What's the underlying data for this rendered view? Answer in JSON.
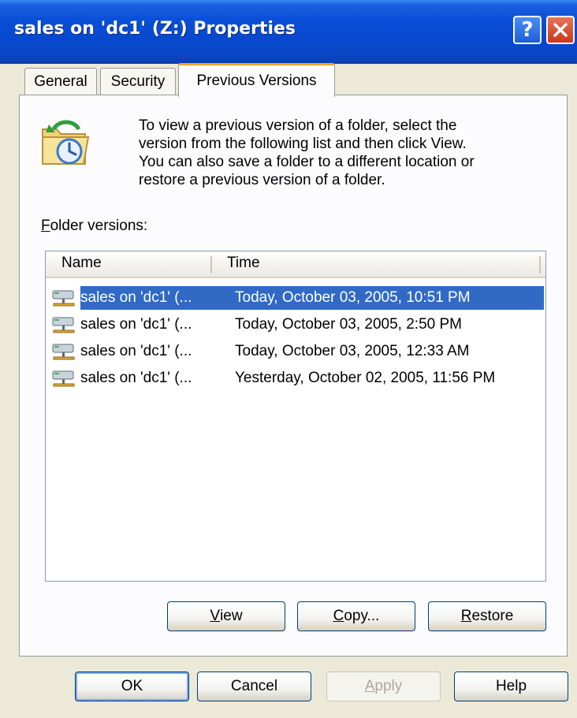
{
  "window": {
    "title": "sales on 'dc1' (Z:) Properties",
    "help_glyph": "?"
  },
  "tabs": [
    {
      "label": "General"
    },
    {
      "label": "Security"
    },
    {
      "label": "Previous Versions",
      "active": true
    }
  ],
  "description": {
    "line1": "To view a previous version of a folder, select the",
    "line2": "version from the following list and then click View.",
    "line3": "You can also save a folder to a different location or",
    "line4": "restore a previous version of a folder."
  },
  "versions_label": {
    "hotkey": "F",
    "rest": "older versions:"
  },
  "list": {
    "columns": {
      "name": "Name",
      "time": "Time"
    },
    "rows": [
      {
        "name": "sales on 'dc1' (...",
        "time": "Today, October 03, 2005, 10:51 PM",
        "selected": true
      },
      {
        "name": "sales on 'dc1' (...",
        "time": "Today, October 03, 2005, 2:50 PM",
        "selected": false
      },
      {
        "name": "sales on 'dc1' (...",
        "time": "Today, October 03, 2005, 12:33 AM",
        "selected": false
      },
      {
        "name": "sales on 'dc1' (...",
        "time": "Yesterday, October 02, 2005, 11:56 PM",
        "selected": false
      }
    ],
    "row_icon": "network-drive-icon"
  },
  "actions": {
    "view": {
      "hotkey": "V",
      "rest": "iew"
    },
    "copy": {
      "hotkey": "C",
      "rest": "opy..."
    },
    "restore": {
      "hotkey": "R",
      "rest": "estore"
    }
  },
  "footer": {
    "ok": "OK",
    "cancel": "Cancel",
    "apply": {
      "hotkey": "A",
      "rest": "pply"
    },
    "help": "Help"
  },
  "colors": {
    "titlebar": "#0a4fd8",
    "selection": "#316ac5",
    "dialog_bg": "#ece9d8",
    "tab_accent": "#f5a623"
  }
}
